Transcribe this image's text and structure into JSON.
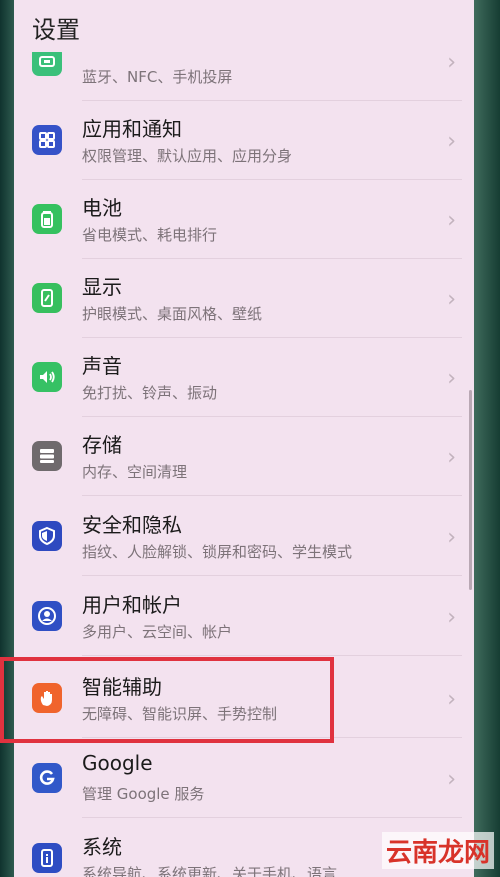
{
  "header": {
    "title": "设置"
  },
  "items": [
    {
      "title": "",
      "subtitle": "蓝牙、NFC、手机投屏",
      "icon": "device-connection-icon",
      "color": "#3ac07a"
    },
    {
      "title": "应用和通知",
      "subtitle": "权限管理、默认应用、应用分身",
      "icon": "apps-grid-icon",
      "color": "#3552c8"
    },
    {
      "title": "电池",
      "subtitle": "省电模式、耗电排行",
      "icon": "battery-icon",
      "color": "#35c15f"
    },
    {
      "title": "显示",
      "subtitle": "护眼模式、桌面风格、壁纸",
      "icon": "display-icon",
      "color": "#37bf5e"
    },
    {
      "title": "声音",
      "subtitle": "免打扰、铃声、振动",
      "icon": "speaker-icon",
      "color": "#36c164"
    },
    {
      "title": "存储",
      "subtitle": "内存、空间清理",
      "icon": "storage-icon",
      "color": "#6f6a6d"
    },
    {
      "title": "安全和隐私",
      "subtitle": "指纹、人脸解锁、锁屏和密码、学生模式",
      "icon": "shield-icon",
      "color": "#2e49c0"
    },
    {
      "title": "用户和帐户",
      "subtitle": "多用户、云空间、帐户",
      "icon": "user-icon",
      "color": "#2f4fc4"
    },
    {
      "title": "智能辅助",
      "subtitle": "无障碍、智能识屏、手势控制",
      "icon": "hand-icon",
      "color": "#f0642c"
    },
    {
      "title": "Google",
      "subtitle": "管理 Google 服务",
      "icon": "google-icon",
      "color": "#3158c9"
    },
    {
      "title": "系统",
      "subtitle": "系统导航、系统更新、关于手机、语言",
      "icon": "system-info-icon",
      "color": "#2e4dc3"
    }
  ],
  "chevron": "›",
  "watermark": "云南龙网"
}
